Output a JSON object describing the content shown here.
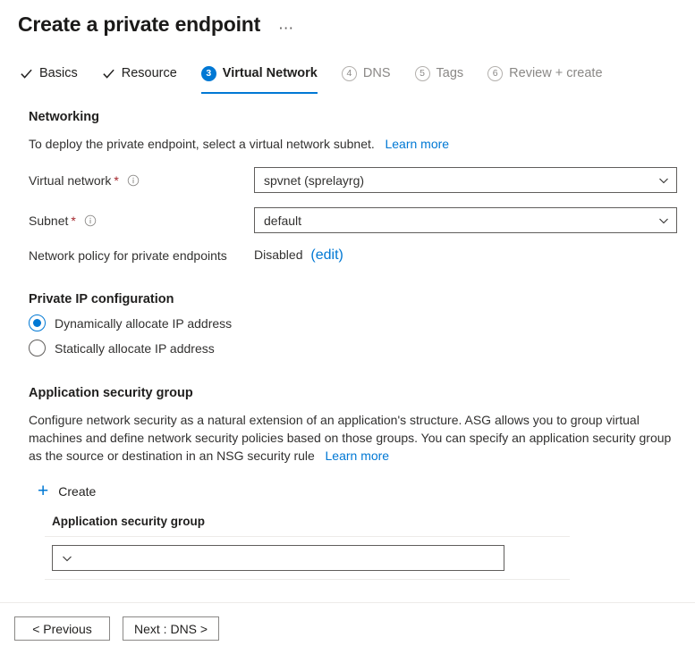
{
  "header": {
    "title": "Create a private endpoint",
    "more_label": "⋯"
  },
  "tabs": [
    {
      "label": "Basics",
      "marker": "check",
      "state": "done"
    },
    {
      "label": "Resource",
      "marker": "check",
      "state": "done"
    },
    {
      "label": "Virtual Network",
      "marker": "3",
      "state": "active"
    },
    {
      "label": "DNS",
      "marker": "4",
      "state": "pending"
    },
    {
      "label": "Tags",
      "marker": "5",
      "state": "pending"
    },
    {
      "label": "Review + create",
      "marker": "6",
      "state": "pending"
    }
  ],
  "networking": {
    "section_title": "Networking",
    "description": "To deploy the private endpoint, select a virtual network subnet.",
    "learn_more": "Learn more",
    "virtual_network": {
      "label": "Virtual network",
      "required_mark": "*",
      "value": "spvnet (sprelayrg)"
    },
    "subnet": {
      "label": "Subnet",
      "required_mark": "*",
      "value": "default"
    },
    "network_policy": {
      "label": "Network policy for private endpoints",
      "value": "Disabled",
      "edit_link": "(edit)"
    }
  },
  "private_ip": {
    "section_title": "Private IP configuration",
    "options": [
      {
        "label": "Dynamically allocate IP address",
        "selected": true
      },
      {
        "label": "Statically allocate IP address",
        "selected": false
      }
    ]
  },
  "asg": {
    "section_title": "Application security group",
    "description": "Configure network security as a natural extension of an application's structure. ASG allows you to group virtual machines and define network security policies based on those groups. You can specify an application security group as the source or destination in an NSG security rule",
    "learn_more": "Learn more",
    "create_label": "Create",
    "column_header": "Application security group",
    "selected_value": ""
  },
  "footer": {
    "previous_label": "< Previous",
    "next_label": "Next : DNS >"
  },
  "colors": {
    "accent": "#0078d4",
    "link": "#0078d4",
    "required": "#a4262c",
    "text": "#323130",
    "muted": "#8a8886"
  }
}
